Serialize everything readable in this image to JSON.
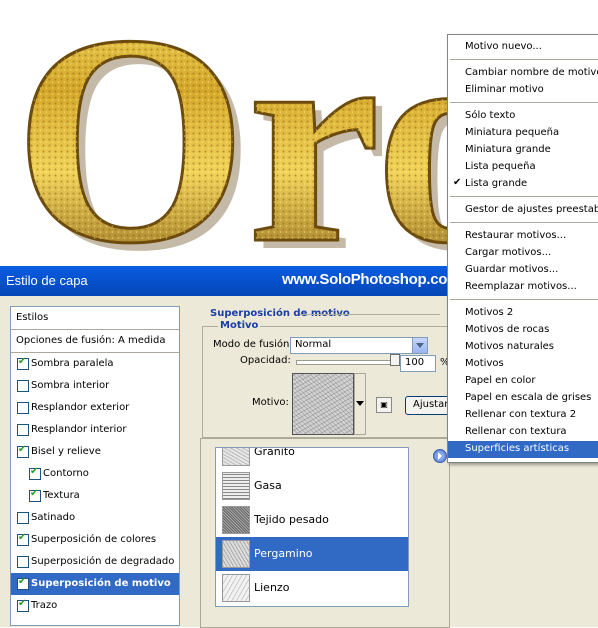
{
  "banner": {
    "text": "Oro",
    "colors": {
      "gold_light": "#f7e36b",
      "gold_mid": "#d4a82a",
      "gold_dark": "#7a5410"
    }
  },
  "dialog": {
    "title": "Estilo de capa",
    "watermark": "www.SoloPhotoshop.com"
  },
  "styles_panel": {
    "header": "Estilos",
    "blend_options": "Opciones de fusión: A medida",
    "items": [
      {
        "label": "Sombra paralela",
        "checked": true,
        "indent": false,
        "selected": false
      },
      {
        "label": "Sombra interior",
        "checked": false,
        "indent": false,
        "selected": false
      },
      {
        "label": "Resplandor exterior",
        "checked": false,
        "indent": false,
        "selected": false
      },
      {
        "label": "Resplandor interior",
        "checked": false,
        "indent": false,
        "selected": false
      },
      {
        "label": "Bisel y relieve",
        "checked": true,
        "indent": false,
        "selected": false
      },
      {
        "label": "Contorno",
        "checked": true,
        "indent": true,
        "selected": false
      },
      {
        "label": "Textura",
        "checked": true,
        "indent": true,
        "selected": false
      },
      {
        "label": "Satinado",
        "checked": false,
        "indent": false,
        "selected": false
      },
      {
        "label": "Superposición de colores",
        "checked": true,
        "indent": false,
        "selected": false
      },
      {
        "label": "Superposición de degradado",
        "checked": false,
        "indent": false,
        "selected": false
      },
      {
        "label": "Superposición de motivo",
        "checked": true,
        "indent": false,
        "selected": true
      },
      {
        "label": "Trazo",
        "checked": true,
        "indent": false,
        "selected": false
      }
    ]
  },
  "settings": {
    "group_title": "Superposición de motivo",
    "subgroup_title": "Motivo",
    "blend_mode_label": "Modo de fusión:",
    "blend_mode_value": "Normal",
    "opacity_label": "Opacidad:",
    "opacity_value": "100",
    "opacity_unit": "%",
    "opacity_level": 1.0,
    "pattern_label": "Motivo:",
    "adjust_button": "Ajustar"
  },
  "pattern_picker": {
    "items": [
      {
        "name": "Granito",
        "selected": false
      },
      {
        "name": "Gasa",
        "selected": false
      },
      {
        "name": "Tejido pesado",
        "selected": false
      },
      {
        "name": "Pergamino",
        "selected": true
      },
      {
        "name": "Lienzo",
        "selected": false
      }
    ]
  },
  "context_menu": {
    "groups": [
      [
        {
          "label": "Motivo nuevo..."
        }
      ],
      [
        {
          "label": "Cambiar nombre de motivo..."
        },
        {
          "label": "Eliminar motivo"
        }
      ],
      [
        {
          "label": "Sólo texto"
        },
        {
          "label": "Miniatura pequeña"
        },
        {
          "label": "Miniatura grande"
        },
        {
          "label": "Lista pequeña"
        },
        {
          "label": "Lista grande",
          "checked": true
        }
      ],
      [
        {
          "label": "Gestor de ajustes preestablecidos..."
        }
      ],
      [
        {
          "label": "Restaurar motivos..."
        },
        {
          "label": "Cargar motivos..."
        },
        {
          "label": "Guardar motivos..."
        },
        {
          "label": "Reemplazar motivos..."
        }
      ],
      [
        {
          "label": "Motivos 2"
        },
        {
          "label": "Motivos de rocas"
        },
        {
          "label": "Motivos naturales"
        },
        {
          "label": "Motivos"
        },
        {
          "label": "Papel en color"
        },
        {
          "label": "Papel en escala de grises"
        },
        {
          "label": "Rellenar con textura 2"
        },
        {
          "label": "Rellenar con textura"
        },
        {
          "label": "Superficies artísticas",
          "selected": true
        }
      ]
    ]
  },
  "colors": {
    "selection": "#316ac5",
    "titlebar": "#0753d1",
    "dialog_bg": "#ece9d8"
  }
}
